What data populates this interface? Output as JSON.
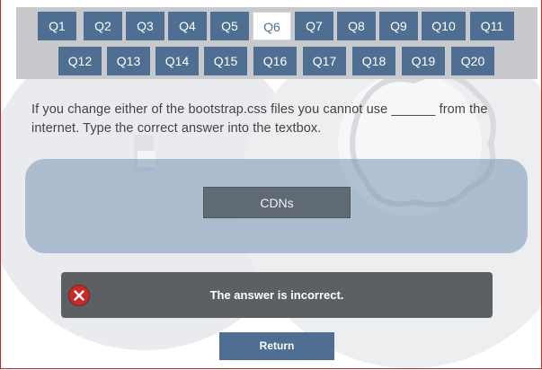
{
  "questions": {
    "row1": [
      "Q1",
      "Q2",
      "Q3",
      "Q4",
      "Q5",
      "Q6",
      "Q7",
      "Q8",
      "Q9",
      "Q10",
      "Q11"
    ],
    "row2": [
      "Q12",
      "Q13",
      "Q14",
      "Q15",
      "Q16",
      "Q17",
      "Q18",
      "Q19",
      "Q20"
    ],
    "active": "Q6"
  },
  "question_text": "If you change either of the bootstrap.css files you cannot use ______ from the internet. Type the correct answer into the textbox.",
  "answer": {
    "value": "CDNs"
  },
  "feedback": {
    "message": "The answer is incorrect.",
    "icon": "error-x-icon"
  },
  "return_button": {
    "label": "Return"
  },
  "colors": {
    "button": "#4e6f91",
    "nav_bar": "#c7c9cc",
    "answer_panel": "#91a7bd",
    "alert_bg": "#5d6063",
    "error": "#c62a2a"
  }
}
